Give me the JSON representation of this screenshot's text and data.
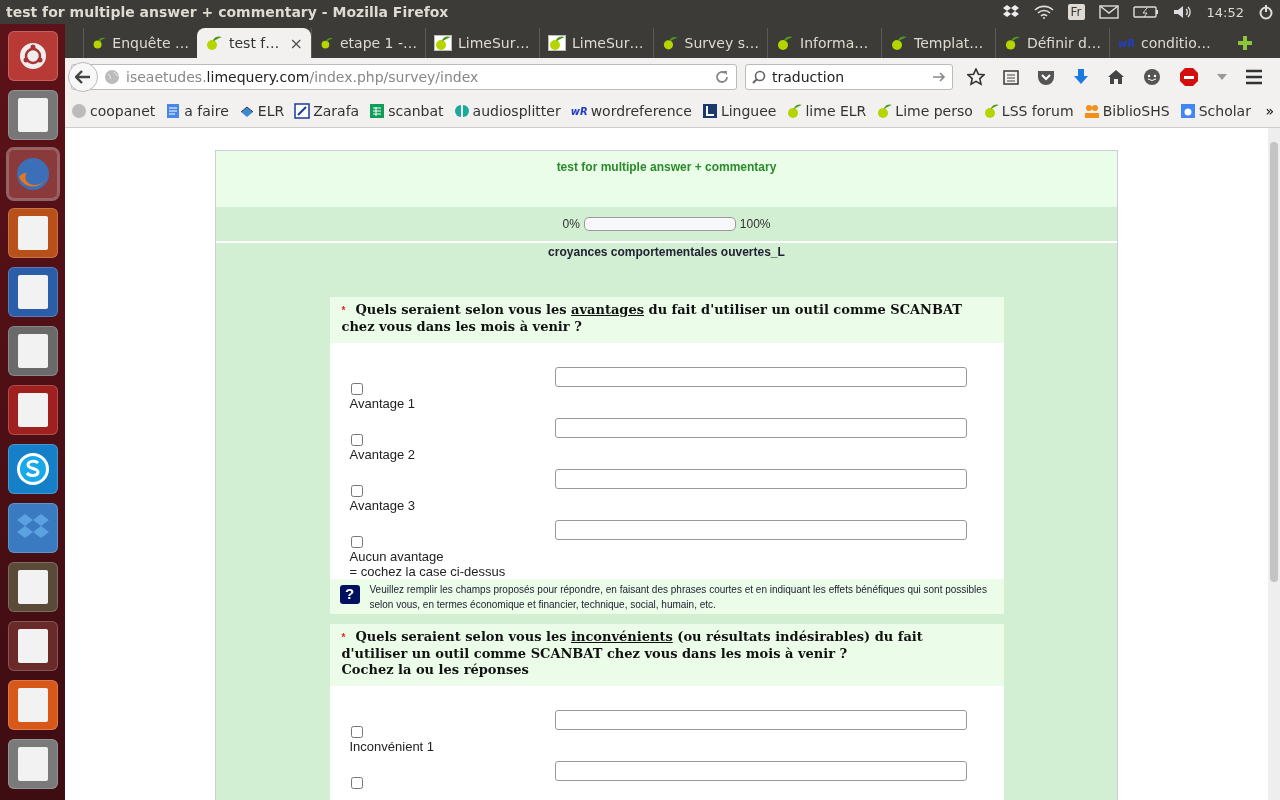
{
  "window": {
    "title": "test for multiple answer + commentary - Mozilla Firefox"
  },
  "panel": {
    "language": "Fr",
    "time": "14:52"
  },
  "tabs": [
    {
      "label": "Enquête …",
      "selected": false
    },
    {
      "label": "test f…",
      "selected": true
    },
    {
      "label": "etape 1 -…",
      "selected": false
    },
    {
      "label": "LimeSur…",
      "selected": false
    },
    {
      "label": "LimeSur…",
      "selected": false
    },
    {
      "label": "Survey s…",
      "selected": false
    },
    {
      "label": "Informa…",
      "selected": false
    },
    {
      "label": "Templat…",
      "selected": false
    },
    {
      "label": "Définir d…",
      "selected": false
    },
    {
      "label": "conditio…",
      "selected": false,
      "logo_text": "wR"
    }
  ],
  "tab_close": "×",
  "url": {
    "prefix": "iseaetudes.",
    "domain": "limequery.com",
    "path": "/index.php/survey/index"
  },
  "search": {
    "value": "traduction"
  },
  "bookmarks": [
    {
      "label": "coopanet"
    },
    {
      "label": "a faire"
    },
    {
      "label": "ELR"
    },
    {
      "label": "Zarafa"
    },
    {
      "label": "scanbat"
    },
    {
      "label": "audiosplitter"
    },
    {
      "label": "wordreference",
      "logo_text": "wR"
    },
    {
      "label": "Linguee"
    },
    {
      "label": "lime ELR"
    },
    {
      "label": "Lime perso"
    },
    {
      "label": "LSS forum"
    },
    {
      "label": "BiblioSHS"
    },
    {
      "label": "Scholar"
    }
  ],
  "bookmarks_more": "»",
  "survey": {
    "title": "test for multiple answer + commentary",
    "progress": {
      "start": "0%",
      "end": "100%",
      "level": 0
    },
    "group_title": "croyances comportementales ouvertes_L",
    "questions": [
      {
        "mandatory": "*",
        "before": "Quels seraient selon vous les ",
        "underlined": "avantages",
        "after": " du fait d'utiliser un outil comme SCANBAT chez vous dans les mois à venir ?",
        "options": [
          {
            "label": "Avantage 1",
            "checked": false
          },
          {
            "label": "Avantage 2",
            "checked": false
          },
          {
            "label": "Avantage 3",
            "checked": false
          },
          {
            "label": "Aucun avantage",
            "note": "= cochez la case ci-dessus",
            "checked": false
          }
        ],
        "help_icon": "?",
        "help": "Veuillez remplir les champs proposés pour répondre, en faisant des phrases courtes et en indiquant les effets bénéfiques qui sont possibles selon vous, en termes économique et financier, technique, social, humain, etc."
      },
      {
        "mandatory": "*",
        "before": "Quels seraient selon vous les ",
        "underlined": "inconvénients",
        "after": " (ou résultats indésirables) du fait d'utiliser un outil comme SCANBAT chez vous dans les mois à venir ?",
        "instruction": "Cochez la ou les réponses",
        "options": [
          {
            "label": "Inconvénient 1",
            "checked": false
          },
          {
            "checked": false
          }
        ]
      }
    ]
  }
}
